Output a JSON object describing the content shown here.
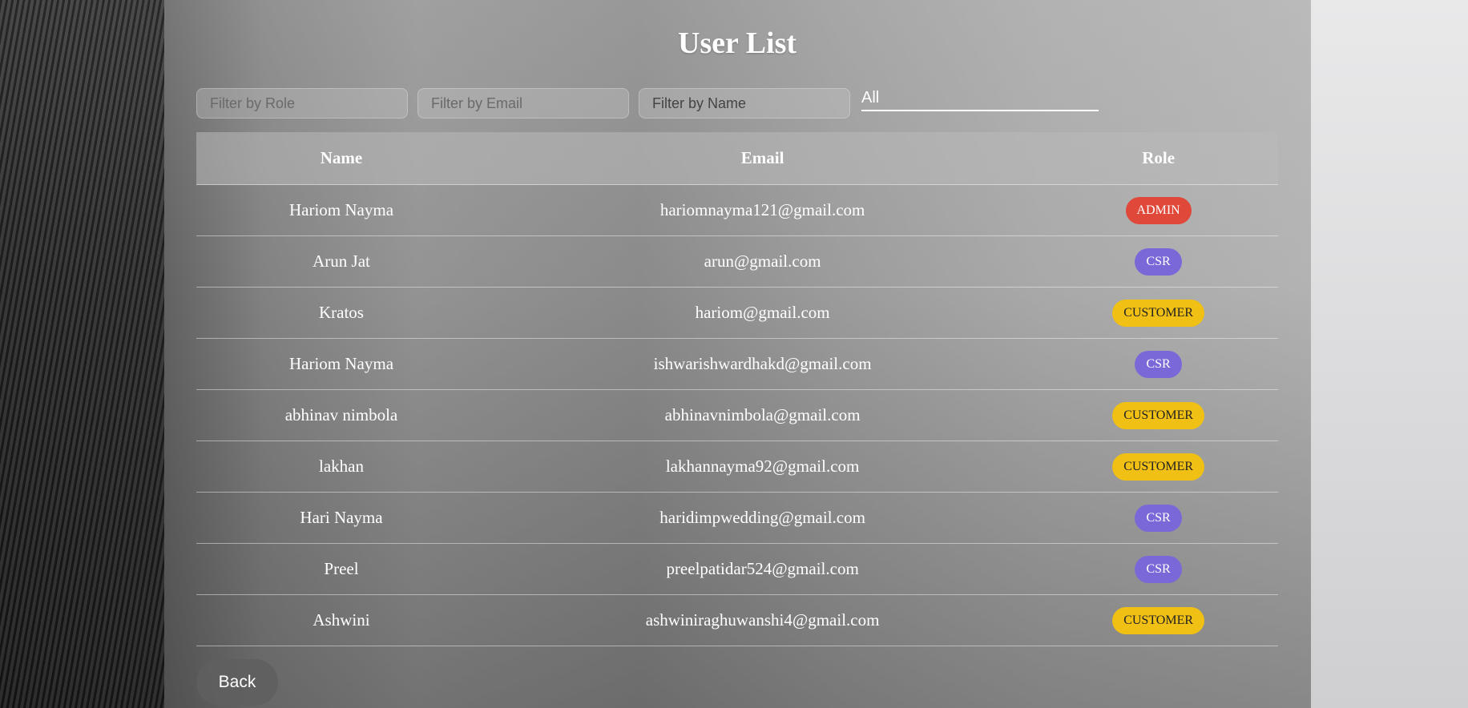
{
  "page": {
    "title": "User List"
  },
  "filters": {
    "role_placeholder": "Filter by Role",
    "email_placeholder": "Filter by Email",
    "name_placeholder": "Filter by Name",
    "role_select_value": "All"
  },
  "table": {
    "headers": {
      "name": "Name",
      "email": "Email",
      "role": "Role"
    },
    "rows": [
      {
        "name": "Hariom Nayma",
        "email": "hariomnayma121@gmail.com",
        "role": "ADMIN",
        "role_type": "admin"
      },
      {
        "name": "Arun Jat",
        "email": "arun@gmail.com",
        "role": "CSR",
        "role_type": "csr"
      },
      {
        "name": "Kratos",
        "email": "hariom@gmail.com",
        "role": "CUSTOMER",
        "role_type": "customer"
      },
      {
        "name": "Hariom Nayma",
        "email": "ishwarishwardhakd@gmail.com",
        "role": "CSR",
        "role_type": "csr"
      },
      {
        "name": "abhinav nimbola",
        "email": "abhinavnimbola@gmail.com",
        "role": "CUSTOMER",
        "role_type": "customer"
      },
      {
        "name": "lakhan",
        "email": "lakhannayma92@gmail.com",
        "role": "CUSTOMER",
        "role_type": "customer"
      },
      {
        "name": "Hari Nayma",
        "email": "haridimpwedding@gmail.com",
        "role": "CSR",
        "role_type": "csr"
      },
      {
        "name": "Preel",
        "email": "preelpatidar524@gmail.com",
        "role": "CSR",
        "role_type": "csr"
      },
      {
        "name": "Ashwini",
        "email": "ashwiniraghuwanshi4@gmail.com",
        "role": "CUSTOMER",
        "role_type": "customer"
      }
    ]
  },
  "buttons": {
    "back_label": "Back"
  },
  "colors": {
    "admin_badge": "#e0483a",
    "csr_badge": "#7b68d8",
    "customer_badge": "#f0c014"
  }
}
